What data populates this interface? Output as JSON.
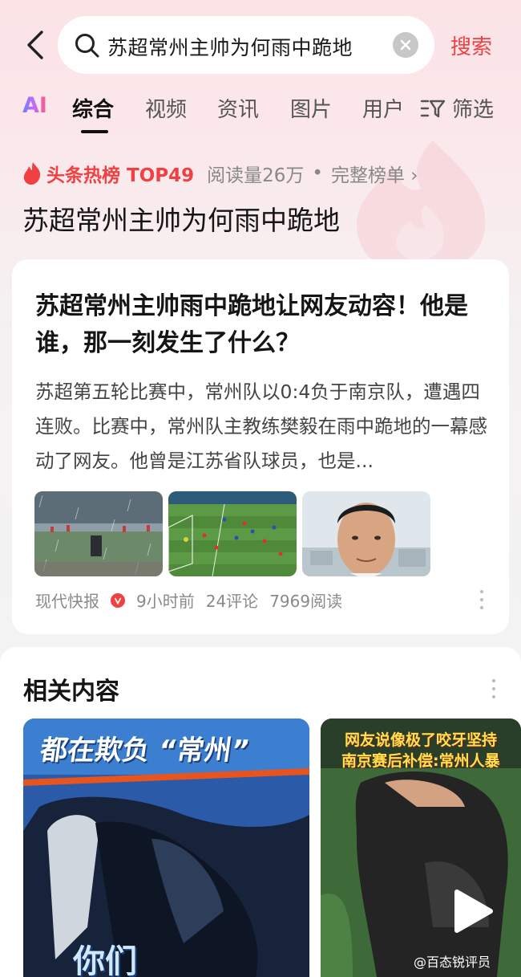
{
  "search": {
    "query": "苏超常州主帅为何雨中跪地",
    "button_label": "搜索"
  },
  "tabs": {
    "ai": "AI",
    "items": [
      "综合",
      "视频",
      "资讯",
      "图片",
      "用户"
    ],
    "active": "综合",
    "filter": "筛选"
  },
  "hotlist": {
    "badge": "头条热榜 TOP49",
    "reads": "阅读量26万",
    "separator": "•",
    "full_list": "完整榜单 ›",
    "title": "苏超常州主帅为何雨中跪地"
  },
  "article": {
    "title": "苏超常州主帅雨中跪地让网友动容！他是谁，那一刻发生了什么？",
    "summary": "苏超第五轮比赛中，常州队以0:4负于南京队，遭遇四连败。比赛中，常州队主教练樊毅在雨中跪地的一幕感动了网友。他曾是江苏省队球员，也是...",
    "source": "现代快报",
    "time": "9小时前",
    "comments": "24评论",
    "reads": "7969阅读"
  },
  "related": {
    "title": "相关内容",
    "videos": [
      {
        "caption_top": "都在欺负 “常州”",
        "caption_bottom": "你们"
      },
      {
        "caption_line1": "网友说像极了咬牙坚持",
        "caption_line2": "南京赛后补偿:常州人暴",
        "watermark": "@百态锐评员"
      }
    ]
  },
  "colors": {
    "accent": "#f04142",
    "text": "#1f1f1f",
    "muted": "#8a8a8a"
  }
}
